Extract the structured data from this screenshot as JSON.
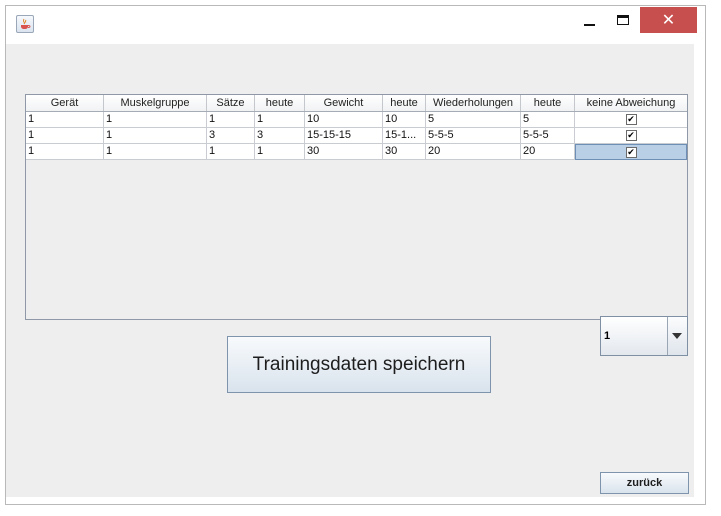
{
  "window": {
    "icon": "java-cup-icon",
    "controls": {
      "minimize": "minimize-icon",
      "maximize": "maximize-icon",
      "close": "✕"
    }
  },
  "table": {
    "columns": [
      "Gerät",
      "Muskelgruppe",
      "Sätze",
      "heute",
      "Gewicht",
      "heute",
      "Wiederholungen",
      "heute",
      "keine Abweichung"
    ],
    "rows": [
      [
        "1",
        "1",
        "1",
        "1",
        "10",
        "10",
        "5",
        "5",
        "✔"
      ],
      [
        "1",
        "1",
        "3",
        "3",
        "15-15-15",
        "15-1...",
        "5-5-5",
        "5-5-5",
        "✔"
      ],
      [
        "1",
        "1",
        "1",
        "1",
        "30",
        "30",
        "20",
        "20",
        "✔"
      ]
    ]
  },
  "combo": {
    "value": "1"
  },
  "buttons": {
    "save": "Trainingsdaten speichern",
    "back": "zurück"
  }
}
